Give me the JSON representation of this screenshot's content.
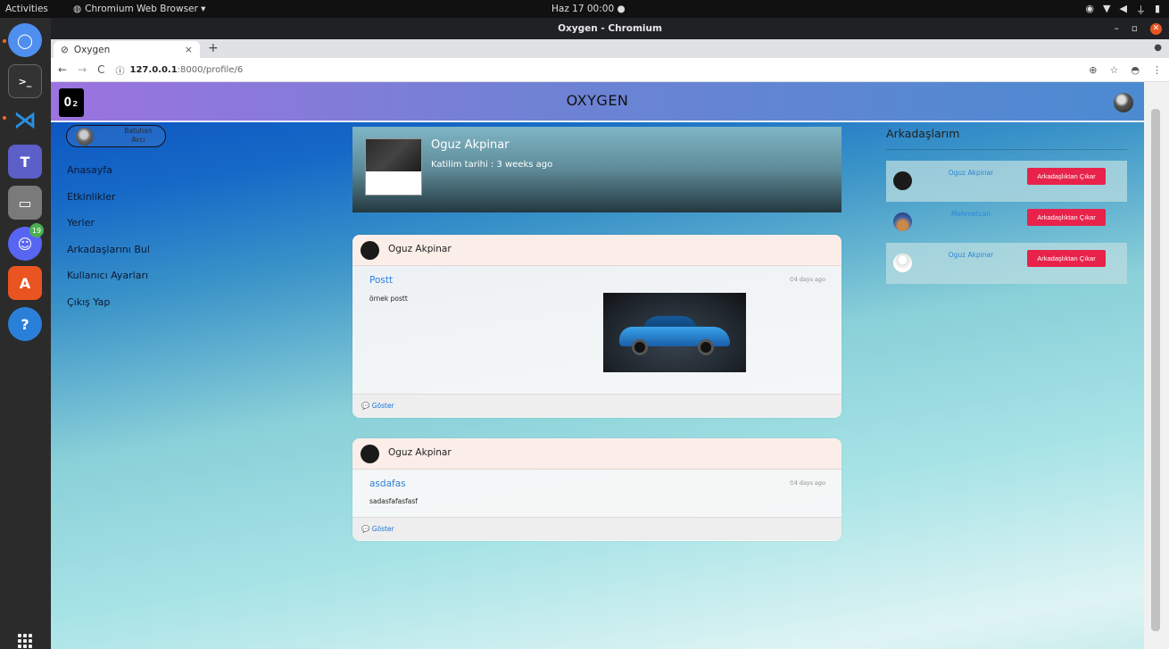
{
  "os": {
    "activities": "Activities",
    "app_menu": "Chromium Web Browser ▾",
    "clock": "Haz 17  00:00  ●",
    "dock_badge": "19"
  },
  "browser": {
    "window_title": "Oxygen - Chromium",
    "tab_title": "Oxygen",
    "url_host": "127.0.0.1",
    "url_path": ":8000/profile/6"
  },
  "page": {
    "site_title": "OXYGEN",
    "logo_text": "O₂",
    "current_user": "Batuhan Avcı",
    "nav": [
      {
        "label": "Anasayfa"
      },
      {
        "label": "Etkinlikler"
      },
      {
        "label": "Yerler"
      },
      {
        "label": "Arkadaşlarını Bul"
      },
      {
        "label": "Kullanıcı Ayarları"
      },
      {
        "label": "Çıkış Yap"
      }
    ],
    "profile": {
      "name": "Oguz Akpinar",
      "joined": "Katilim tarihi : 3 weeks ago"
    },
    "posts": [
      {
        "author": "Oguz Akpinar",
        "title": "Postt",
        "time": "⏲4 days ago",
        "body": "örnek postt",
        "show": "💬 Göster"
      },
      {
        "author": "Oguz Akpinar",
        "title": "asdafas",
        "time": "⏲4 days ago",
        "body": "sadasfafasfasf",
        "show": "💬 Göster"
      }
    ],
    "friends": {
      "title": "Arkadaşlarım",
      "items": [
        {
          "name": "Oguz Akpinar",
          "action": "Arkadaşlıktan Çıkar"
        },
        {
          "name": "Mehmetcan",
          "action": "Arkadaşlıktan Çıkar"
        },
        {
          "name": "Oguz Akpinar",
          "action": "Arkadaşlıktan Çıkar"
        }
      ]
    }
  },
  "colors": {
    "header_gradient_start": "#9c73df",
    "header_gradient_end": "#4b8bd1",
    "danger_button": "#e8224a",
    "link_blue": "#2e80d8",
    "ubuntu_orange": "#e95420"
  }
}
